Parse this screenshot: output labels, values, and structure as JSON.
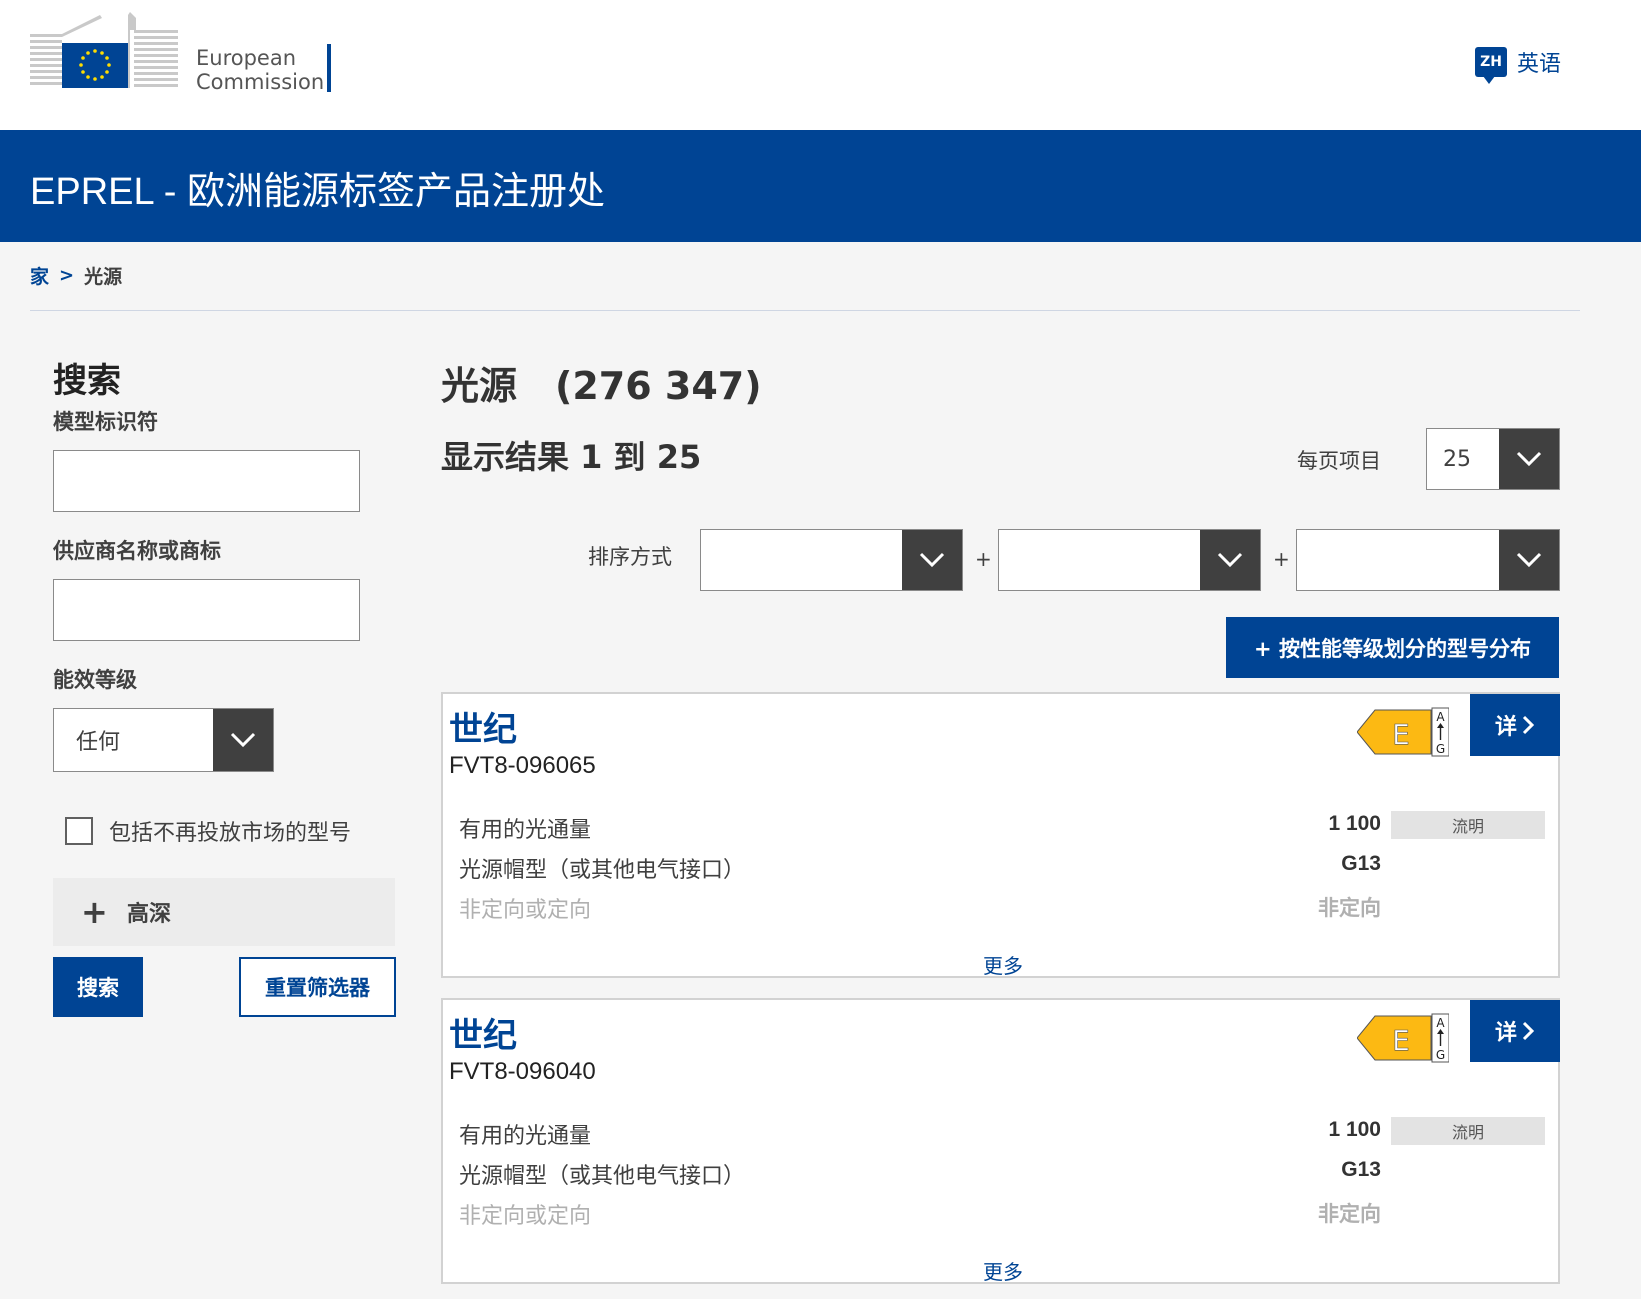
{
  "header": {
    "logo_line1": "European",
    "logo_line2": "Commission",
    "lang_code": "ZH",
    "lang_label": "英语"
  },
  "banner": {
    "title": "EPREL - 欧洲能源标签产品注册处"
  },
  "breadcrumb": {
    "home": "家",
    "separator": ">",
    "current": "光源"
  },
  "sidebar": {
    "title": "搜索",
    "model_label": "模型标识符",
    "model_value": "",
    "supplier_label": "供应商名称或商标",
    "supplier_value": "",
    "class_label": "能效等级",
    "class_value": "任何",
    "checkbox_label": "包括不再投放市场的型号",
    "advanced_label": "高深",
    "search_button": "搜索",
    "reset_button": "重置筛选器"
  },
  "main": {
    "title": "光源　(276 347)",
    "result_info": "显示结果 1 到 25",
    "per_page_label": "每页项目",
    "per_page_value": "25",
    "sort_label": "排序方式",
    "sort_plus": "+",
    "distribution_button": "+ 按性能等级划分的型号分布"
  },
  "products": [
    {
      "brand": "世纪",
      "model": "FVT8-096065",
      "energy_class": "E",
      "scale_top": "A",
      "scale_bottom": "G",
      "detail_button": "详",
      "specs": [
        {
          "name": "有用的光通量",
          "value": "1 100",
          "unit": "流明"
        },
        {
          "name": "光源帽型（或其他电气接口）",
          "value": "G13"
        },
        {
          "name": "非定向或定向",
          "value": "非定向"
        }
      ],
      "more_link": "更多"
    },
    {
      "brand": "世纪",
      "model": "FVT8-096040",
      "energy_class": "E",
      "scale_top": "A",
      "scale_bottom": "G",
      "detail_button": "详",
      "specs": [
        {
          "name": "有用的光通量",
          "value": "1 100",
          "unit": "流明"
        },
        {
          "name": "光源帽型（或其他电气接口）",
          "value": "G13"
        },
        {
          "name": "非定向或定向",
          "value": "非定向"
        }
      ],
      "more_link": "更多"
    }
  ],
  "colors": {
    "brand_blue": "#004494",
    "energy_e": "#fcb913",
    "dark_arrow_bg": "#404040"
  }
}
